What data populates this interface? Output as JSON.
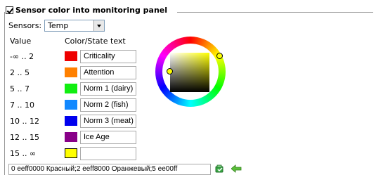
{
  "panel": {
    "title": "Sensor color into monitoring panel",
    "enabled": true
  },
  "sensors": {
    "label": "Sensors:",
    "selected": "Temp"
  },
  "table": {
    "header_value": "Value",
    "header_color": "Color/State text",
    "rows": [
      {
        "range": "-∞ .. 2",
        "color": "#ee0000",
        "text": "Criticality"
      },
      {
        "range": "2 .. 5",
        "color": "#ff8000",
        "text": "Attention"
      },
      {
        "range": "5 .. 7",
        "color": "#11ee11",
        "text": "Norm 1 (dairy)"
      },
      {
        "range": "7 .. 10",
        "color": "#1188ff",
        "text": "Norm 2 (fish)"
      },
      {
        "range": "10 .. 12",
        "color": "#0000ee",
        "text": "Norm 3 (meat)"
      },
      {
        "range": "12 .. 15",
        "color": "#880088",
        "text": "Ice Age"
      },
      {
        "range": "15 .. ∞",
        "color": "#ffff00",
        "text": ""
      }
    ]
  },
  "color_picker": {
    "selected_color": "#ffff00"
  },
  "bottom_bar": {
    "value": "0 eeff0000 Красный;2 eeff8000 Оранжевый;5 ee00ff",
    "apply_icon": "apply-icon",
    "back_icon": "back-arrow-icon"
  }
}
